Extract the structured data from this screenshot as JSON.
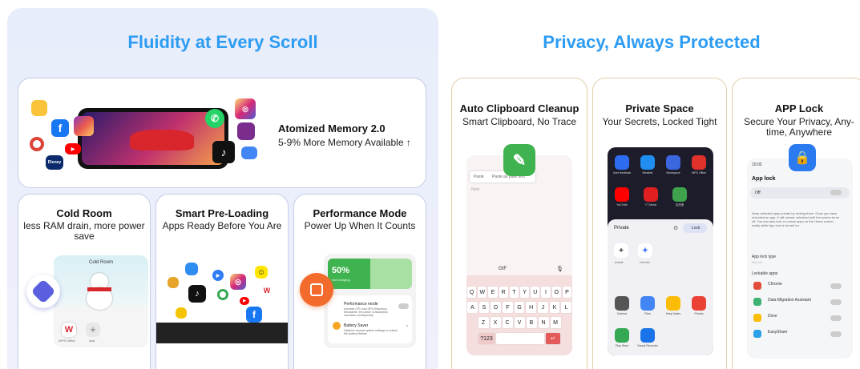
{
  "left": {
    "title": "Fluidity at Every Scroll",
    "memory": {
      "title": "Atomized Memory 2.0",
      "subtitle": "5-9% More Memory Available ↑"
    },
    "cold_room": {
      "title": "Cold Room",
      "subtitle": "less RAM drain, more power save",
      "screen_label": "Cold Room",
      "app_a": "WPS Office",
      "app_b": "Add"
    },
    "preload": {
      "title": "Smart Pre-Loading",
      "subtitle": "Apps Ready Before You Are"
    },
    "performance": {
      "title": "Performance Mode",
      "subtitle": "Power Up When It Counts",
      "battery_percent": "50%",
      "battery_fill": 0.5,
      "battery_status": "Not charging",
      "mode1_title": "Performance mode",
      "mode1_desc": "Increase CPU and GPU frequency. Meanwhile, the power consumption increases consequently.",
      "mode2_title": "Battery Saver",
      "mode2_desc": "Optimize several system settings to extend the battery lifetime"
    }
  },
  "right": {
    "title": "Privacy, Always Protected",
    "clipboard": {
      "title": "Auto Clipboard Cleanup",
      "subtitle": "Smart Clipboard, No Trace",
      "paste": "Paste",
      "paste_plain": "Paste as plain text",
      "note": "Note",
      "gif": "GIF",
      "row1": [
        "Q",
        "W",
        "E",
        "R",
        "T",
        "Y",
        "U",
        "I",
        "O",
        "P"
      ],
      "row2": [
        "A",
        "S",
        "D",
        "F",
        "G",
        "H",
        "J",
        "K",
        "L"
      ],
      "row3": [
        "Z",
        "X",
        "C",
        "V",
        "B",
        "N",
        "M"
      ],
      "num_key": "?123"
    },
    "private_space": {
      "title": "Private Space",
      "subtitle": "Your Secrets, Locked Tight",
      "apps_top": [
        "User feedback",
        "Weather",
        "Workspace",
        "WPS Office"
      ],
      "apps_mid": [
        "YouTube",
        "YT Music",
        "应用宝"
      ],
      "private_label": "Private",
      "lock_label": "Lock",
      "install": "Install",
      "gemini": "Gemini",
      "apps_bottom": [
        "Camera",
        "Files",
        "Keep Notes",
        "Photos"
      ],
      "apps_last": [
        "Play Store",
        "Sound Recorder"
      ]
    },
    "app_lock": {
      "title": "APP Lock",
      "subtitle": "Secure Your Privacy, Any-time, Anywhere",
      "status_time": "10:02",
      "header": "App lock",
      "off": "Off",
      "desc": "Keep selected apps private by locking them. Once you have unlocked an app, it will remain unlocked until the screen turns off. You can also lock or unlock apps on the Home screen easily while App lock is turned on.",
      "type_label": "App lock type",
      "type_value": "Not set",
      "lockable": "Lockable apps",
      "apps": [
        "Chrome",
        "Data Migration Assistant",
        "Drive",
        "EasyShare"
      ],
      "colors": [
        "#e44d3a",
        "#3cb371",
        "#fbbc05",
        "#2aa1e8"
      ]
    }
  }
}
